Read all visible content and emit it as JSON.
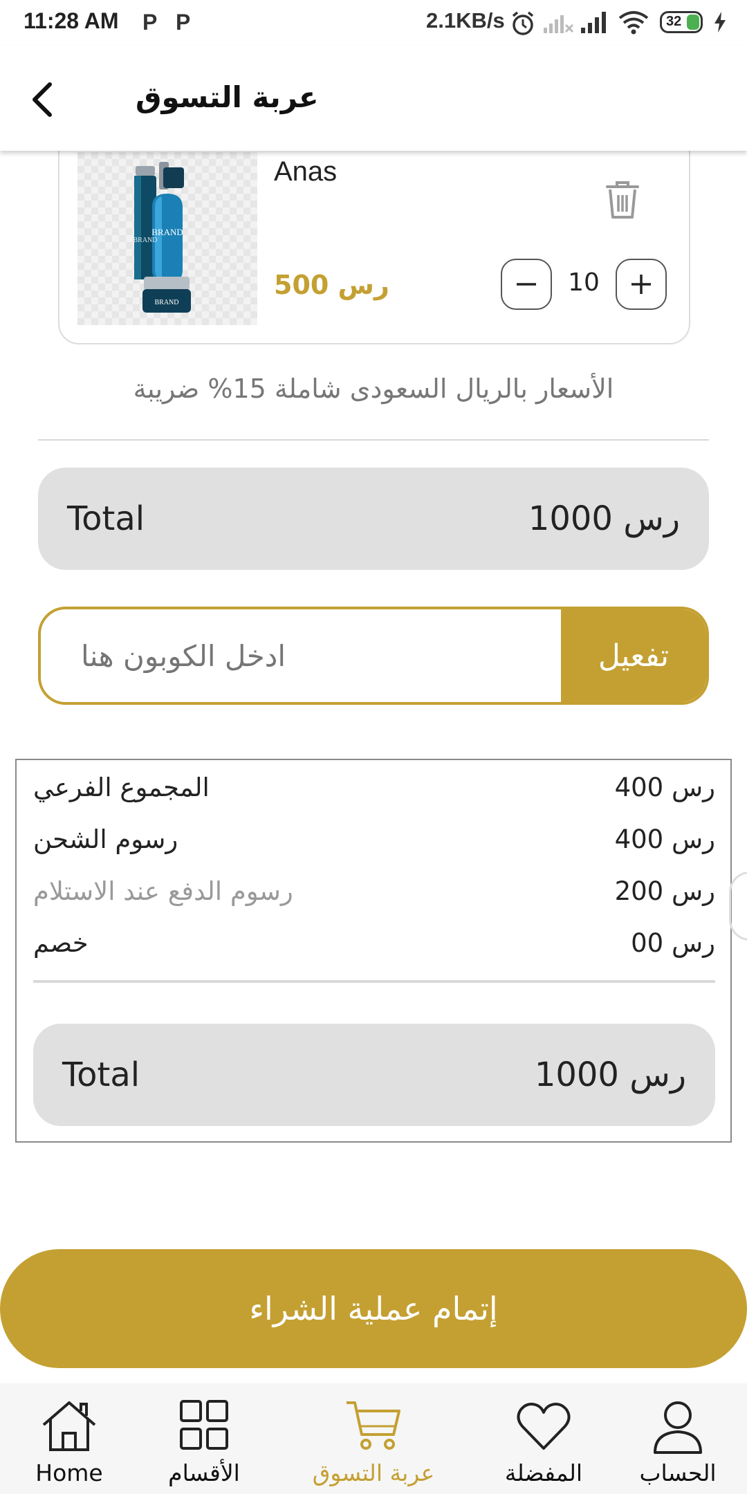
{
  "status_bar": {
    "time": "11:28 AM",
    "notification_icons": [
      "P",
      "P"
    ],
    "network_speed": "2.1KB/s",
    "battery": "32"
  },
  "header": {
    "title": "عربة التسوق",
    "back_icon": "chevron-left-icon"
  },
  "cart_item": {
    "name": "Anas",
    "price": "رس 500",
    "quantity": "10",
    "image_brand_text": "BRAND",
    "minus_icon": "minus-icon",
    "plus_icon": "plus-icon",
    "delete_icon": "trash-icon"
  },
  "tax_note": "الأسعار بالريال السعودى شاملة 15% ضريبة",
  "total_top": {
    "label": "Total",
    "value": "رس 1000"
  },
  "coupon": {
    "placeholder": "ادخل الكوبون هنا",
    "button_label": "تفعيل"
  },
  "summary": {
    "rows": [
      {
        "label": "المجموع الفرعي",
        "value": "رس 400"
      },
      {
        "label": "رسوم الشحن",
        "value": "رس 400"
      },
      {
        "label": "رسوم الدفع عند الاستلام",
        "value": "رس 200"
      },
      {
        "label": "خصم",
        "value": "رس 00"
      }
    ],
    "total_label": "Total",
    "total_value": "رس 1000"
  },
  "checkout_label": "إتمام عملية الشراء",
  "bottom_nav": {
    "items": [
      {
        "label": "Home",
        "icon": "home-icon"
      },
      {
        "label": "الأقسام",
        "icon": "grid-icon"
      },
      {
        "label": "عربة التسوق",
        "icon": "cart-icon"
      },
      {
        "label": "المفضلة",
        "icon": "heart-icon"
      },
      {
        "label": "الحساب",
        "icon": "user-icon"
      }
    ],
    "active_index": 2
  },
  "colors": {
    "accent": "#c4a032",
    "pill_bg": "#e0e0e0",
    "muted_text": "#999999"
  }
}
